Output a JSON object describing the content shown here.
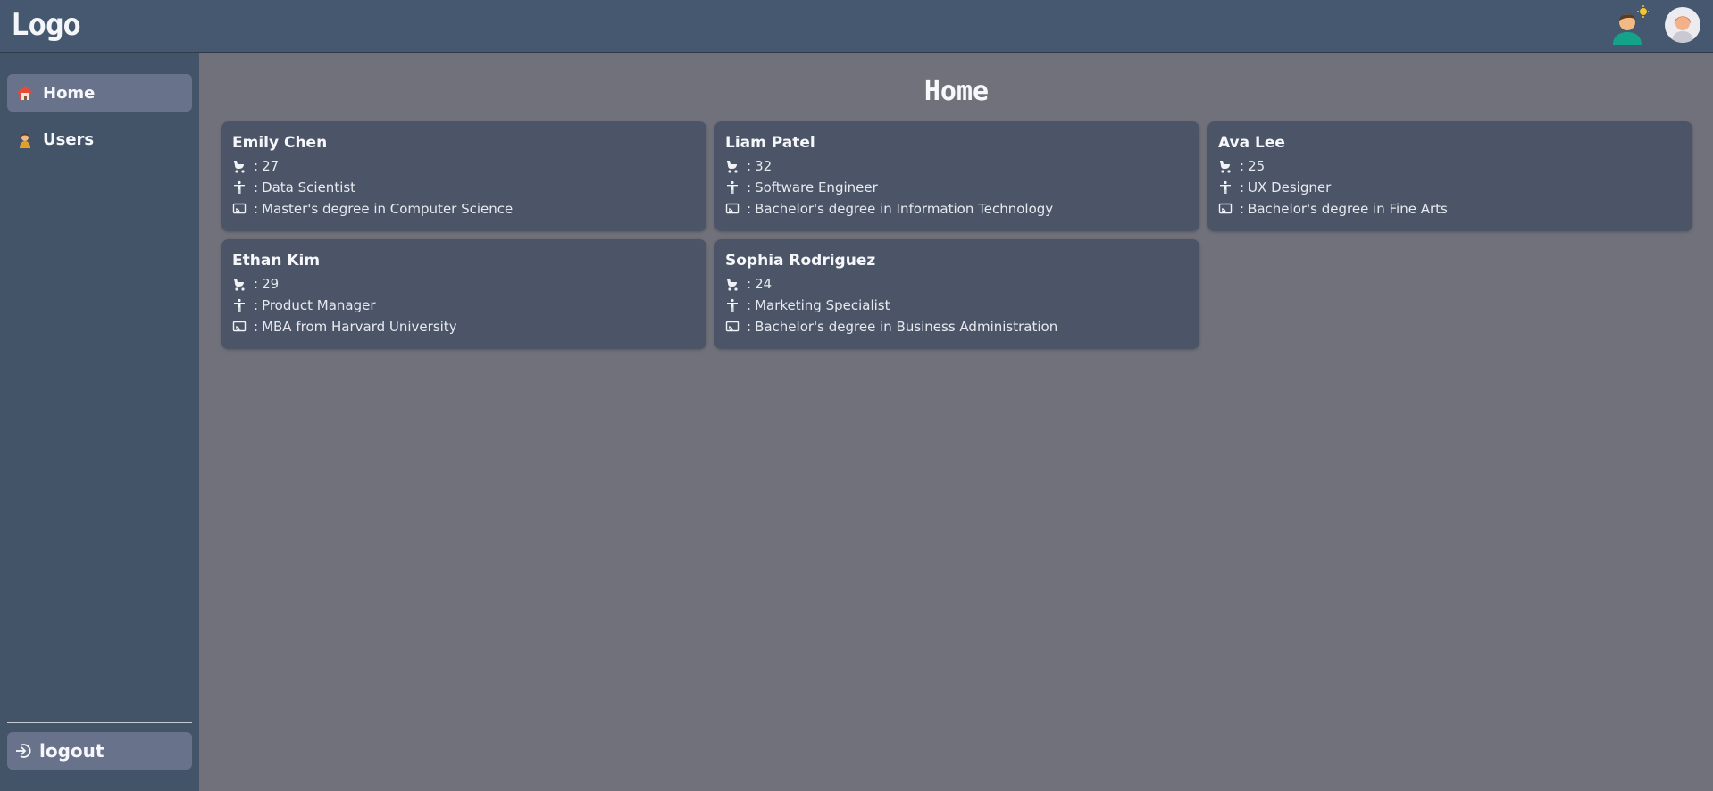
{
  "header": {
    "logo": "Logo"
  },
  "sidebar": {
    "items": [
      {
        "label": "Home",
        "icon": "house-icon",
        "active": true
      },
      {
        "label": "Users",
        "icon": "person-icon",
        "active": false
      }
    ],
    "logout_label": "logout"
  },
  "main": {
    "title": "Home",
    "separator": ":",
    "cards": [
      {
        "name": "Emily Chen",
        "age": "27",
        "role": "Data Scientist",
        "education": "Master's degree in Computer Science"
      },
      {
        "name": "Liam Patel",
        "age": "32",
        "role": "Software Engineer",
        "education": "Bachelor's degree in Information Technology"
      },
      {
        "name": "Ava Lee",
        "age": "25",
        "role": "UX Designer",
        "education": "Bachelor's degree in Fine Arts"
      },
      {
        "name": "Ethan Kim",
        "age": "29",
        "role": "Product Manager",
        "education": "MBA from Harvard University"
      },
      {
        "name": "Sophia Rodriguez",
        "age": "24",
        "role": "Marketing Specialist",
        "education": "Bachelor's degree in Business Administration"
      }
    ]
  },
  "colors": {
    "topbar": "#455870",
    "sidebar": "#435469",
    "background": "#71717b",
    "card": "#4b5567",
    "active_nav": "#68728a"
  }
}
